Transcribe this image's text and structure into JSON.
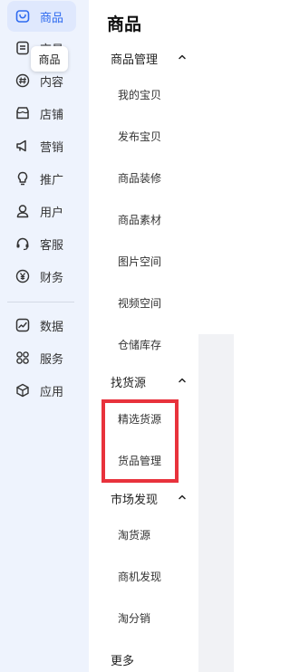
{
  "rail": {
    "items": [
      {
        "label": "商品",
        "icon": "product-bag-icon",
        "active": true
      },
      {
        "label": "交易",
        "icon": "order-doc-icon",
        "active": false
      },
      {
        "label": "内容",
        "icon": "hashtag-icon",
        "active": false
      },
      {
        "label": "店铺",
        "icon": "store-icon",
        "active": false
      },
      {
        "label": "营销",
        "icon": "megaphone-icon",
        "active": false
      },
      {
        "label": "推广",
        "icon": "bulb-icon",
        "active": false
      },
      {
        "label": "用户",
        "icon": "user-icon",
        "active": false
      },
      {
        "label": "客服",
        "icon": "headset-icon",
        "active": false
      },
      {
        "label": "财务",
        "icon": "yuan-icon",
        "active": false
      },
      {
        "label": "数据",
        "icon": "chart-line-icon",
        "active": false
      },
      {
        "label": "服务",
        "icon": "grid-dots-icon",
        "active": false
      },
      {
        "label": "应用",
        "icon": "cube-icon",
        "active": false
      }
    ],
    "tooltip": "商品"
  },
  "panel": {
    "title": "商品",
    "groups": [
      {
        "label": "商品管理",
        "expanded": true,
        "items": [
          "我的宝贝",
          "发布宝贝",
          "商品装修",
          "商品素材",
          "图片空间",
          "视频空间",
          "仓储库存"
        ]
      },
      {
        "label": "找货源",
        "expanded": true,
        "items": [
          "精选货源",
          "货品管理"
        ]
      },
      {
        "label": "市场发现",
        "expanded": true,
        "items": [
          "淘货源",
          "商机发现",
          "淘分销"
        ]
      }
    ],
    "more": "更多"
  },
  "colors": {
    "accent": "#2f6bf0",
    "rail_bg": "#eef3fd",
    "highlight": "#e8323c"
  }
}
